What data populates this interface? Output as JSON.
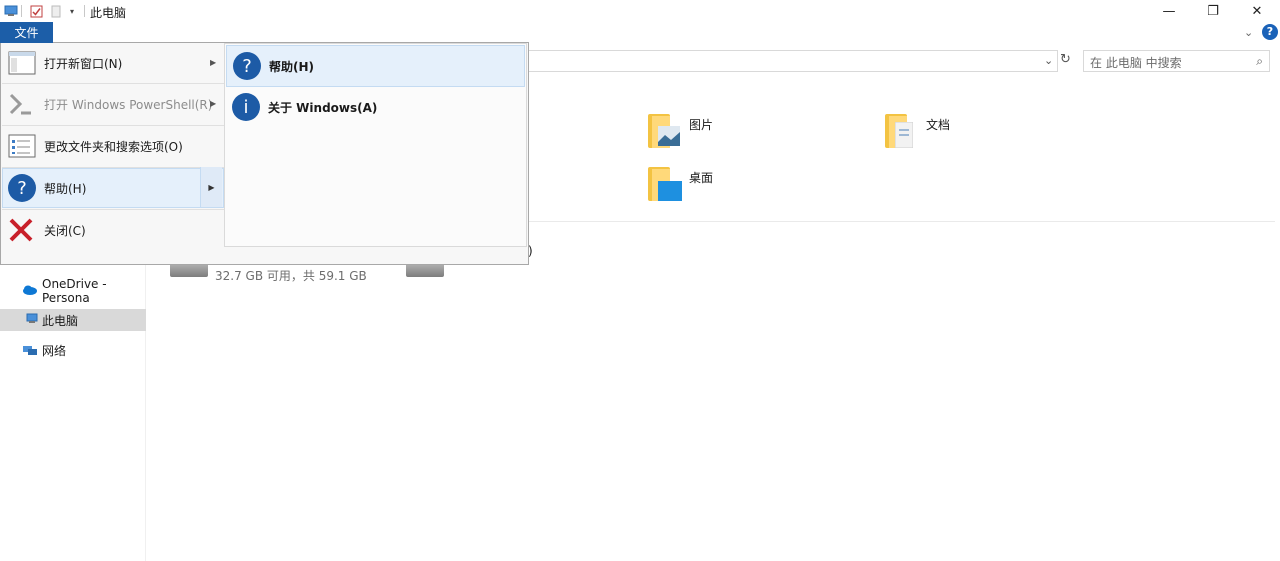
{
  "window": {
    "title": "此电脑",
    "minimize_glyph": "—",
    "maximize_glyph": "❐",
    "close_glyph": "✕",
    "help_glyph": "?"
  },
  "ribbon": {
    "file_tab_label": "文件"
  },
  "search": {
    "placeholder": "在 此电脑 中搜索"
  },
  "file_menu": {
    "items": [
      {
        "label": "打开新窗口(N)",
        "icon": "new-window-icon",
        "has_submenu": true,
        "disabled": false
      },
      {
        "label": "打开 Windows PowerShell(R)",
        "icon": "powershell-icon",
        "has_submenu": true,
        "disabled": true
      },
      {
        "label": "更改文件夹和搜索选项(O)",
        "icon": "folder-options-icon",
        "has_submenu": false,
        "disabled": false
      },
      {
        "label": "帮助(H)",
        "icon": "help-icon",
        "has_submenu": true,
        "disabled": false,
        "highlighted": true
      },
      {
        "label": "关闭(C)",
        "icon": "close-icon",
        "has_submenu": false,
        "disabled": false
      }
    ],
    "submenu": [
      {
        "label": "帮助(H)",
        "icon": "help-icon",
        "glyph": "?"
      },
      {
        "label": "关于 Windows(A)",
        "icon": "info-icon",
        "glyph": "i"
      }
    ]
  },
  "sidebar": {
    "items": [
      {
        "label": "OneDrive - Persona",
        "icon": "onedrive-icon",
        "selected": false
      },
      {
        "label": "此电脑",
        "icon": "computer-icon",
        "selected": true
      },
      {
        "label": "网络",
        "icon": "network-icon",
        "selected": false
      }
    ]
  },
  "content": {
    "folders": [
      {
        "label": "图片",
        "icon": "pictures-folder-icon"
      },
      {
        "label": "文档",
        "icon": "documents-folder-icon"
      },
      {
        "label": "桌面",
        "icon": "desktop-folder-icon"
      }
    ],
    "drive_info": "32.7 GB 可用，共 59.1 GB",
    "drive_label_fragment": ")"
  },
  "colors": {
    "accent": "#1c5ea8",
    "highlight": "#e5f0fb",
    "folder": "#f3c342"
  }
}
